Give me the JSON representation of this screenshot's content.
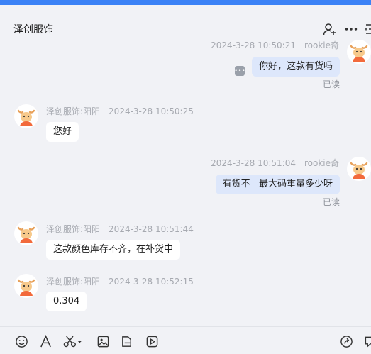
{
  "header": {
    "title": "泽创服饰"
  },
  "messages": [
    {
      "sender": "rookie奇",
      "time": "2024-3-28 10:50:21",
      "text": "你好，这款有货吗",
      "status": "已读"
    },
    {
      "sender": "泽创服饰:阳阳",
      "time": "2024-3-28 10:50:25",
      "text": "您好"
    },
    {
      "sender": "rookie奇",
      "time": "2024-3-28 10:51:04",
      "text": "有货不   最大码重量多少呀",
      "status": "已读"
    },
    {
      "sender": "泽创服饰:阳阳",
      "time": "2024-3-28 10:51:44",
      "text": "这款颜色库存不齐，在补货中"
    },
    {
      "sender": "泽创服饰:阳阳",
      "time": "2024-3-28 10:52:15",
      "text": "0.304"
    }
  ],
  "icons": {
    "header": [
      "add-user-icon",
      "more-icon",
      "menu-icon"
    ],
    "toolbar": [
      "emoji-icon",
      "font-icon",
      "scissors-icon",
      "image-icon",
      "folder-icon",
      "video-icon",
      "send-link-icon",
      "chat-icon"
    ]
  }
}
